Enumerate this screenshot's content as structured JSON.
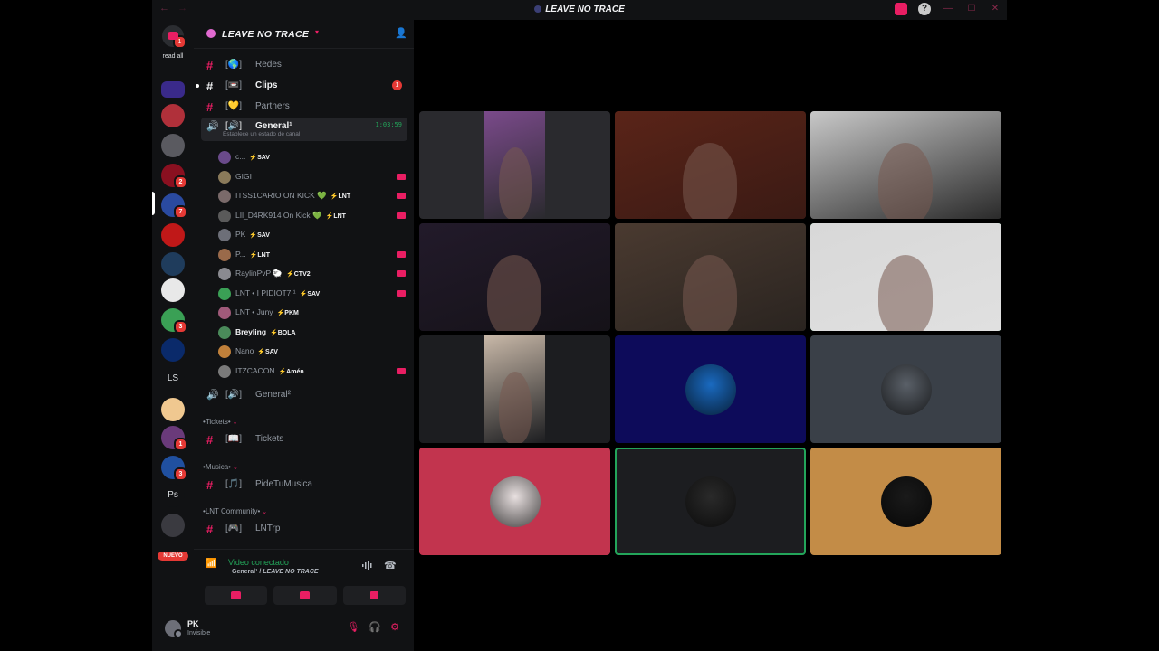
{
  "window": {
    "title": "LEAVE NO TRACE",
    "nav_back": "←",
    "nav_forward": "→",
    "controls": {
      "minimize": "—",
      "maximize": "☐",
      "close": "✕"
    },
    "inbox_icon": "inbox-icon",
    "help_icon": "?"
  },
  "rail": {
    "read_all": "read all",
    "dm_badge": "1",
    "servers": [
      {
        "initials": "",
        "color": "#3a2a8a",
        "badge": ""
      },
      {
        "initials": "",
        "color": "#b0303a",
        "badge": ""
      },
      {
        "initials": "",
        "color": "#5a5a60",
        "badge": ""
      },
      {
        "initials": "",
        "color": "#8a1020",
        "badge": "2"
      },
      {
        "initials": "",
        "color": "#2a4aa0",
        "badge": "7"
      },
      {
        "initials": "",
        "color": "#c01818",
        "badge": ""
      },
      {
        "initials": "",
        "color": "#1f3c5c",
        "badge": ""
      },
      {
        "initials": "",
        "color": "#e8e8e8",
        "badge": ""
      },
      {
        "initials": "",
        "color": "#3aa055",
        "badge": "3"
      },
      {
        "initials": "",
        "color": "#0a2a6a",
        "badge": ""
      },
      {
        "initials": "LS",
        "color": "#111214",
        "badge": ""
      },
      {
        "initials": "",
        "color": "#f0c890",
        "badge": ""
      },
      {
        "initials": "",
        "color": "#6a3a7a",
        "badge": "1"
      },
      {
        "initials": "",
        "color": "#2050a0",
        "badge": "3"
      },
      {
        "initials": "Ps",
        "color": "#111214",
        "badge": ""
      },
      {
        "initials": "",
        "color": "#3a3a40",
        "badge": ""
      }
    ],
    "nuevo": "NUEVO"
  },
  "guild": {
    "name": "LEAVE NO TRACE",
    "channels_top": [
      {
        "emoji": "🌎",
        "name": "Redes",
        "bright": false,
        "badge": ""
      },
      {
        "emoji": "📼",
        "name": "Clips",
        "bright": true,
        "badge": "1"
      },
      {
        "emoji": "💛",
        "name": "Partners",
        "bright": false,
        "badge": ""
      }
    ],
    "voice_active": {
      "name": "General¹",
      "timer": "1:03:59",
      "status": "Establece un estado de canal"
    },
    "voice_users": [
      {
        "name": "c...",
        "tag": "SAV",
        "bold": false,
        "cam": false,
        "avatar": "#6a4a8a"
      },
      {
        "name": "GIGI",
        "tag": "",
        "bold": false,
        "cam": true,
        "avatar": "#8a7a5a"
      },
      {
        "name": "ITSS1CARIO ON KICK 💚",
        "tag": "LNT",
        "bold": false,
        "cam": true,
        "avatar": "#7a6a6a"
      },
      {
        "name": "LIl_D4RK914 On Kick 💚",
        "tag": "LNT",
        "bold": false,
        "cam": true,
        "avatar": "#5a5a5a"
      },
      {
        "name": "PK",
        "tag": "SAV",
        "bold": false,
        "cam": false,
        "avatar": "#6d6f78"
      },
      {
        "name": "P...",
        "tag": "LNT",
        "bold": false,
        "cam": true,
        "avatar": "#9a6a4a"
      },
      {
        "name": "RaylinPvP 🐑",
        "tag": "CTV2",
        "bold": false,
        "cam": true,
        "avatar": "#8a8a90"
      },
      {
        "name": "LNT • I PIDIOT7 ¹",
        "tag": "SAV",
        "bold": false,
        "cam": true,
        "avatar": "#3aa055"
      },
      {
        "name": "LNT • Juny",
        "tag": "PKM",
        "bold": false,
        "cam": false,
        "avatar": "#a05a7a"
      },
      {
        "name": "Breyling",
        "tag": "BOLA",
        "bold": true,
        "cam": false,
        "avatar": "#4a8a5a"
      },
      {
        "name": "Nano",
        "tag": "SAV",
        "bold": false,
        "cam": false,
        "avatar": "#c0803a"
      },
      {
        "name": "ITZCACON",
        "tag": "Amén",
        "bold": false,
        "cam": true,
        "avatar": "#7a7a7a"
      }
    ],
    "voice_second": "General²",
    "categories": [
      {
        "name": "Tickets",
        "channel": "Tickets",
        "emoji": "📖"
      },
      {
        "name": "Musica",
        "channel": "PideTuMusica",
        "emoji": "🎵"
      },
      {
        "name": "LNT Community",
        "channel": "LNTrp",
        "emoji": "🎮"
      }
    ]
  },
  "voice_panel": {
    "title": "Video conectado",
    "channel": "General¹",
    "guild": "LEAVE NO TRACE"
  },
  "user": {
    "name": "PK",
    "status": "Invisible"
  },
  "stage": {
    "tiles": [
      {
        "kind": "video",
        "bg": "#2a2a2e",
        "frame_color": "#7a4a8a",
        "narrow": true
      },
      {
        "kind": "video",
        "bg": "#3a1a14",
        "frame_color": "#5a2418",
        "narrow": false
      },
      {
        "kind": "video",
        "bg": "#2a2a2a",
        "frame_color": "#c8c8c8",
        "narrow": false
      },
      {
        "kind": "video",
        "bg": "#151218",
        "frame_color": "#221a2a",
        "narrow": false
      },
      {
        "kind": "video",
        "bg": "#2a2420",
        "frame_color": "#4a3a30",
        "narrow": false
      },
      {
        "kind": "video",
        "bg": "#e0e0e0",
        "frame_color": "#d8d8d8",
        "narrow": false,
        "speaking": true
      },
      {
        "kind": "video",
        "bg": "#1c1d20",
        "frame_color": "#c8b8a8",
        "narrow": true
      },
      {
        "kind": "avatar",
        "bg": "#0d0b5a",
        "avatar_color": "#1a6ac0"
      },
      {
        "kind": "avatar",
        "bg": "#3a4048",
        "avatar_color": "#5a6068"
      },
      {
        "kind": "avatar",
        "bg": "#c2344e",
        "avatar_color": "#e8e0e0"
      },
      {
        "kind": "avatar",
        "bg": "#1c1d20",
        "avatar_color": "#2a2a2a",
        "speaking": true
      },
      {
        "kind": "avatar",
        "bg": "#c38c47",
        "avatar_color": "#1a1a1a"
      }
    ]
  }
}
